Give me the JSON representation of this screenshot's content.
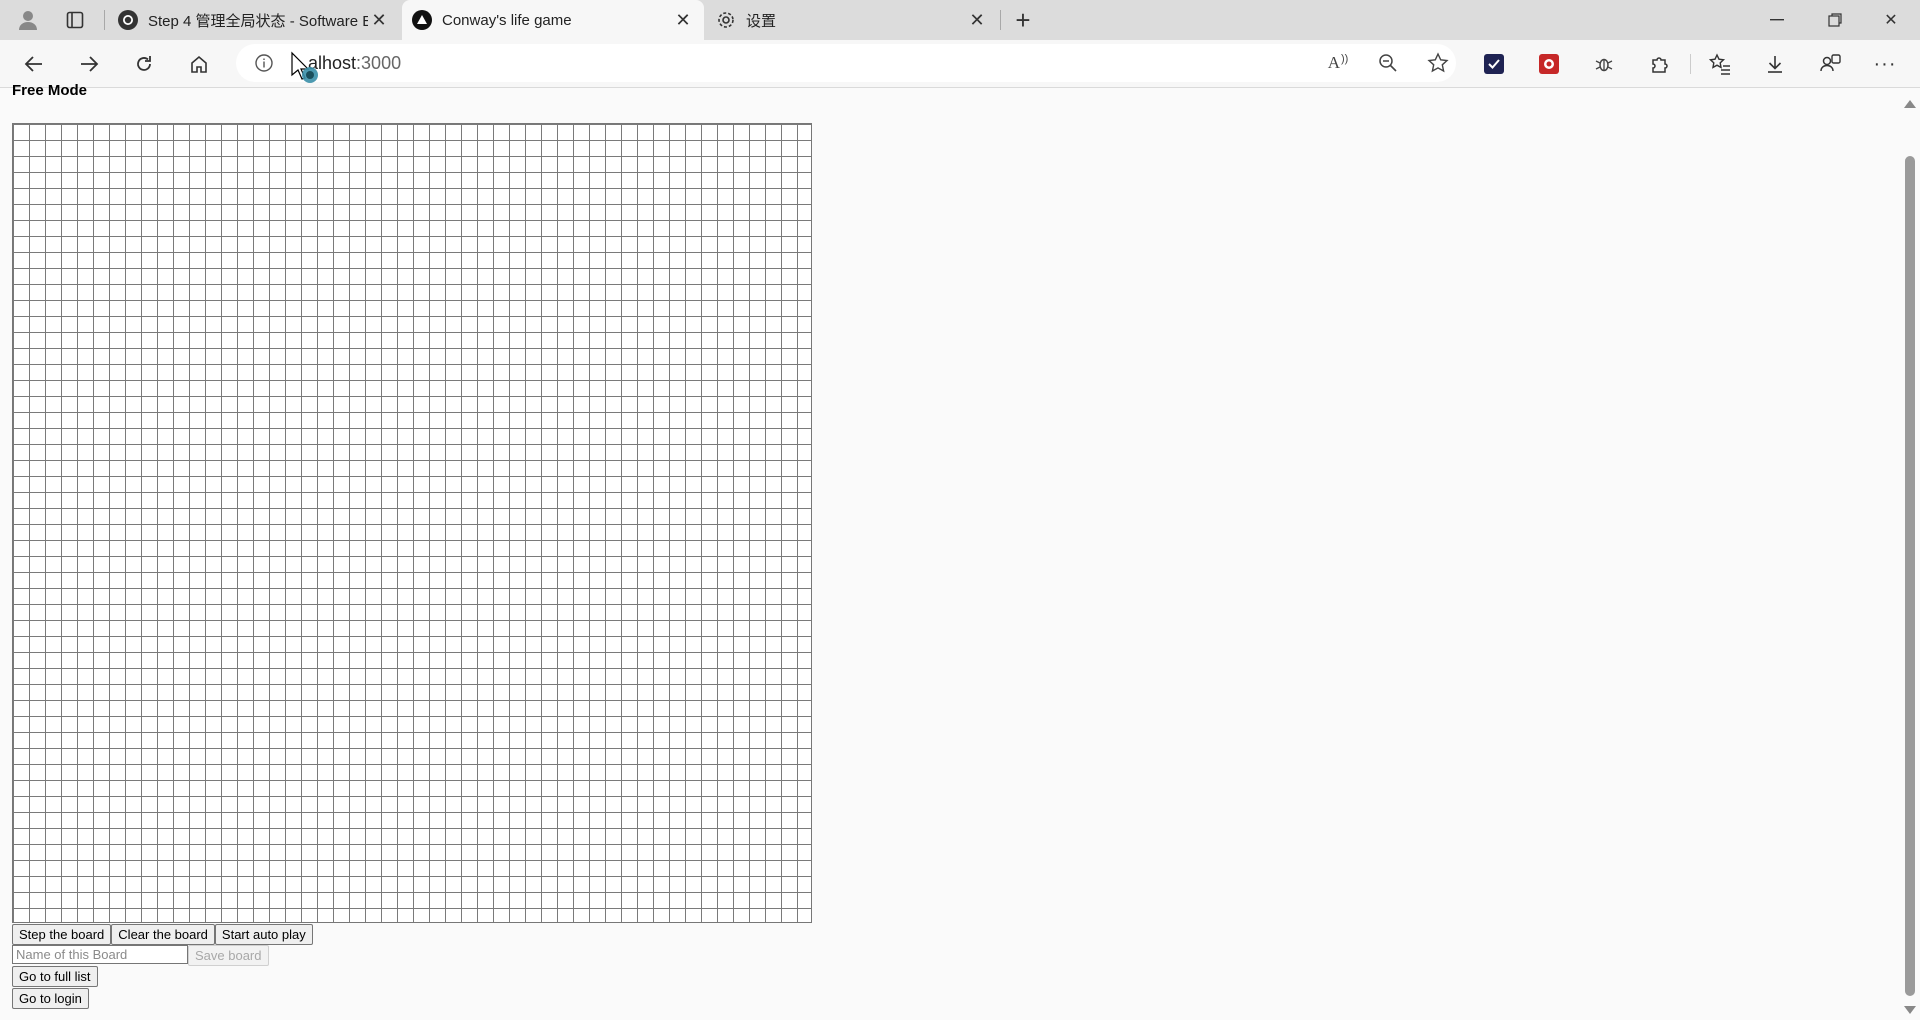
{
  "browser": {
    "tabs": [
      {
        "title": "Step 4 管理全局状态 - Software E",
        "icon": "github-icon",
        "active": false
      },
      {
        "title": "Conway's life game",
        "icon": "react-app-icon",
        "active": true
      },
      {
        "title": "设置",
        "icon": "gear-icon",
        "active": false
      }
    ],
    "new_tab_glyph": "+",
    "address": {
      "host_visible": "alhost",
      "port": ":3000",
      "full": "localhost:3000"
    }
  },
  "page": {
    "mode_title": "Free Mode",
    "board": {
      "rows": 50,
      "cols": 50,
      "live_cells": 0
    },
    "buttons": {
      "step": "Step the board",
      "clear": "Clear the board",
      "auto": "Start auto play",
      "save": "Save board",
      "full_list": "Go to full list",
      "login": "Go to login"
    },
    "name_input": {
      "placeholder": "Name of this Board",
      "value": ""
    }
  },
  "colors": {
    "accent_ext_1": "#2b2bb5",
    "accent_ext_2": "#d12b2b"
  }
}
